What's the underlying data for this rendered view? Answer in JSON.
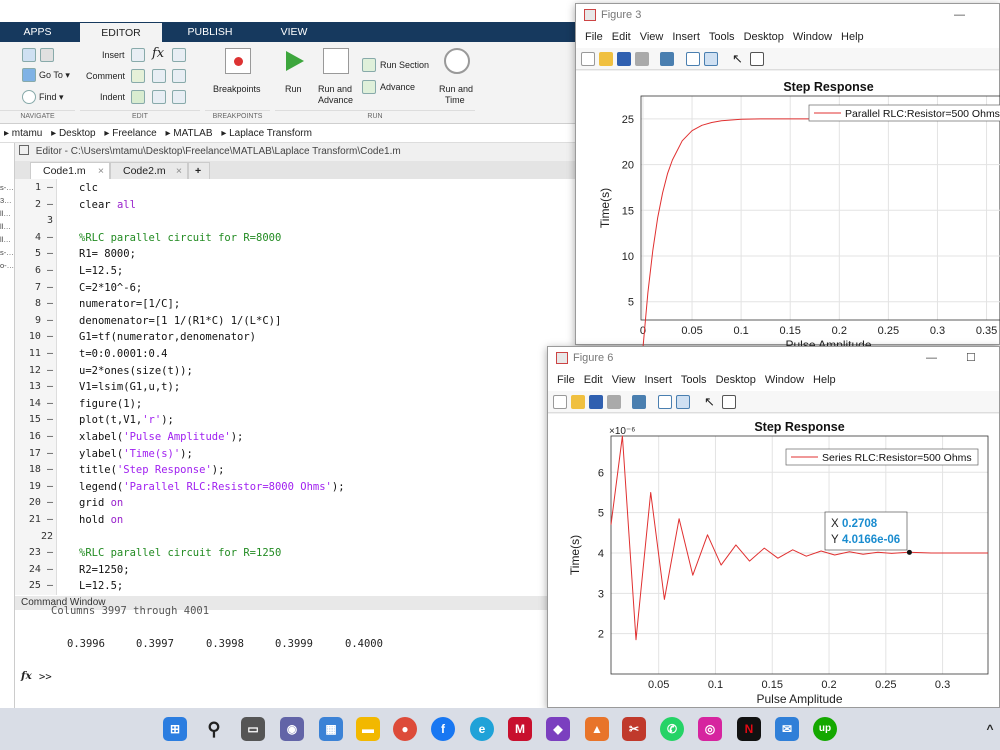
{
  "ribbon": {
    "tabs": [
      "APPS",
      "EDITOR",
      "PUBLISH",
      "VIEW"
    ],
    "active_tab": "EDITOR",
    "navigate": {
      "goto": "Go To ▾",
      "find": "Find ▾",
      "section": "NAVIGATE"
    },
    "edit": {
      "insert": "Insert",
      "comment": "Comment",
      "indent": "Indent",
      "section": "EDIT"
    },
    "breakpoints": {
      "label": "Breakpoints",
      "section": "BREAKPOINTS"
    },
    "run": {
      "run": "Run",
      "run_advance_1": "Run and",
      "run_advance_2": "Advance",
      "run_section": "Run Section",
      "advance": "Advance",
      "run_time_1": "Run and",
      "run_time_2": "Time",
      "section": "RUN"
    }
  },
  "address": {
    "crumbs": [
      "▸ mtamu",
      "▸ Desktop",
      "▸ Freelance",
      "▸ MATLAB",
      "▸ Laplace Transform"
    ]
  },
  "left_strip": [
    "s-…",
    "3…",
    "ll…",
    "ll…",
    "ll…",
    "s-…",
    "o-…"
  ],
  "editor": {
    "title": "Editor - C:\\Users\\mtamu\\Desktop\\Freelance\\MATLAB\\Laplace Transform\\Code1.m",
    "tabs": [
      "Code1.m",
      "Code2.m"
    ],
    "add_tab": "+",
    "lines": [
      {
        "n": "1 –",
        "t": "clc"
      },
      {
        "n": "2 –",
        "t": "clear all"
      },
      {
        "n": "3",
        "t": ""
      },
      {
        "n": "4 –",
        "t": "%RLC parallel circuit for R=8000"
      },
      {
        "n": "5 –",
        "t": "R1= 8000;"
      },
      {
        "n": "6 –",
        "t": "L=12.5;"
      },
      {
        "n": "7 –",
        "t": "C=2*10^-6;"
      },
      {
        "n": "8 –",
        "t": "numerator=[1/C];"
      },
      {
        "n": "9 –",
        "t": "denomenator=[1 1/(R1*C) 1/(L*C)]"
      },
      {
        "n": "10 –",
        "t": "G1=tf(numerator,denomenator)"
      },
      {
        "n": "11 –",
        "t": "t=0:0.0001:0.4"
      },
      {
        "n": "12 –",
        "t": "u=2*ones(size(t));"
      },
      {
        "n": "13 –",
        "t": "V1=lsim(G1,u,t);"
      },
      {
        "n": "14 –",
        "t": "figure(1);"
      },
      {
        "n": "15 –",
        "t": "plot(t,V1,'r');"
      },
      {
        "n": "16 –",
        "t": "xlabel('Pulse Amplitude');"
      },
      {
        "n": "17 –",
        "t": "ylabel('Time(s)');"
      },
      {
        "n": "18 –",
        "t": "title('Step Response');"
      },
      {
        "n": "19 –",
        "t": "legend('Parallel RLC:Resistor=8000 Ohms');"
      },
      {
        "n": "20 –",
        "t": "grid on"
      },
      {
        "n": "21 –",
        "t": "hold on"
      },
      {
        "n": "22",
        "t": ""
      },
      {
        "n": "23 –",
        "t": "%RLC parallel circuit for R=1250"
      },
      {
        "n": "24 –",
        "t": "R2=1250;"
      },
      {
        "n": "25 –",
        "t": "L=12.5;"
      }
    ]
  },
  "command_window": {
    "title": "Command Window",
    "partial_line": "Columns 3997 through 4001",
    "values": [
      "0.3996",
      "0.3997",
      "0.3998",
      "0.3999",
      "0.4000"
    ],
    "prompt_icon": "fx",
    "prompt": ">>"
  },
  "figure3": {
    "window_title": "Figure 3",
    "menu": [
      "File",
      "Edit",
      "View",
      "Insert",
      "Tools",
      "Desktop",
      "Window",
      "Help"
    ],
    "controls": {
      "minimize": "—"
    }
  },
  "figure6": {
    "window_title": "Figure 6",
    "menu": [
      "File",
      "Edit",
      "View",
      "Insert",
      "Tools",
      "Desktop",
      "Window",
      "Help"
    ],
    "controls": {
      "minimize": "—",
      "maximize": "☐"
    },
    "datatip": {
      "x_label": "X",
      "x_value": "0.2708",
      "y_label": "Y",
      "y_value": "4.0166e-06"
    }
  },
  "chart_data": [
    {
      "type": "line",
      "title": "Step Response",
      "xlabel": "Pulse Amplitude",
      "ylabel": "Time(s)",
      "xlim": [
        -0.002,
        0.38
      ],
      "ylim": [
        3,
        27.5
      ],
      "xticks": [
        "0",
        "0.05",
        "0.1",
        "0.15",
        "0.2",
        "0.25",
        "0.3",
        "0.35"
      ],
      "yticks": [
        "5",
        "10",
        "15",
        "20",
        "25"
      ],
      "grid": true,
      "legend_position": "top-right",
      "series": [
        {
          "name": "Parallel RLC:Resistor=500 Ohms",
          "color": "#e03030",
          "x": [
            0,
            0.005,
            0.01,
            0.015,
            0.02,
            0.025,
            0.03,
            0.04,
            0.05,
            0.06,
            0.07,
            0.08,
            0.1,
            0.12,
            0.15,
            0.2,
            0.25,
            0.3,
            0.35,
            0.38
          ],
          "y": [
            0,
            6.0,
            10.6,
            14.2,
            16.9,
            19.0,
            20.5,
            22.6,
            23.7,
            24.3,
            24.6,
            24.8,
            24.95,
            25.0,
            25.0,
            25.0,
            25.0,
            25.0,
            25.0,
            25.0
          ]
        }
      ]
    },
    {
      "type": "line",
      "title": "Step Response",
      "xlabel": "Pulse Amplitude",
      "ylabel": "Time(s)",
      "y_exponent": "×10⁻⁶",
      "xlim": [
        0.008,
        0.34
      ],
      "ylim": [
        1.0,
        6.9
      ],
      "xticks": [
        "0.05",
        "0.1",
        "0.15",
        "0.2",
        "0.25",
        "0.3"
      ],
      "yticks": [
        "2",
        "3",
        "4",
        "5",
        "6"
      ],
      "grid": true,
      "legend_position": "top-right",
      "series": [
        {
          "name": "Series RLC:Resistor=500 Ohms",
          "color": "#e03030",
          "x": [
            0.008,
            0.018,
            0.03,
            0.043,
            0.055,
            0.068,
            0.08,
            0.093,
            0.105,
            0.118,
            0.13,
            0.143,
            0.155,
            0.168,
            0.18,
            0.193,
            0.205,
            0.218,
            0.23,
            0.243,
            0.255,
            0.27,
            0.29,
            0.31,
            0.34
          ],
          "y": [
            4.7,
            6.9,
            1.85,
            5.5,
            2.85,
            4.85,
            3.45,
            4.45,
            3.7,
            4.2,
            3.8,
            4.12,
            3.87,
            4.08,
            3.92,
            4.05,
            3.95,
            4.03,
            3.97,
            4.02,
            3.99,
            4.0166,
            4.0,
            4.0,
            4.0
          ]
        }
      ]
    }
  ]
}
